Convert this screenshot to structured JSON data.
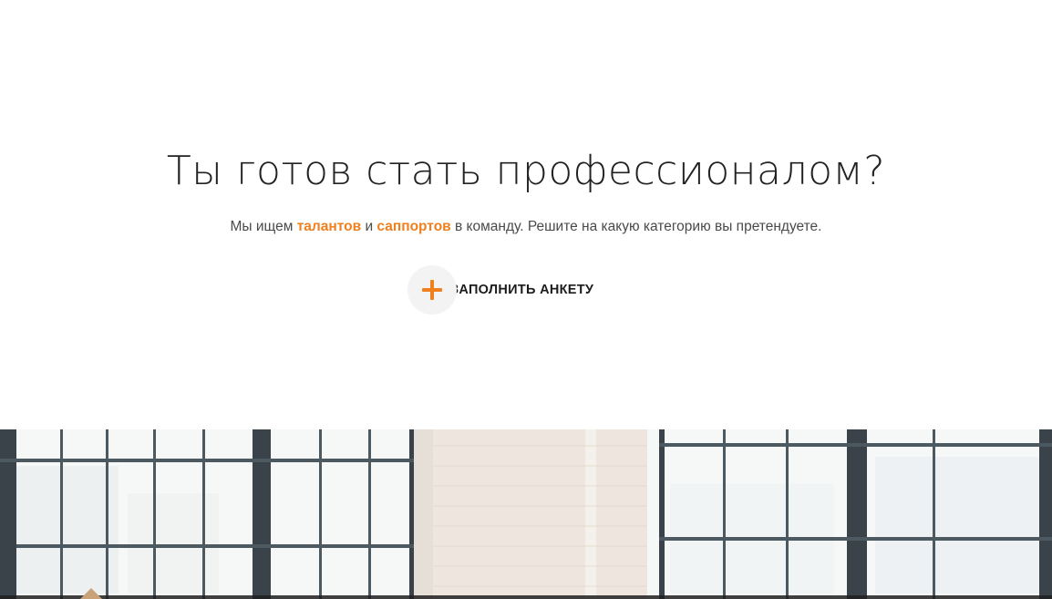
{
  "hero": {
    "title": "Ты готов стать профессионалом?",
    "subtitle": {
      "prefix": "Мы ищем ",
      "link1": "талантов",
      "middle": " и ",
      "link2": "саппортов",
      "suffix": " в команду. Решите на какую категорию вы претендуете."
    },
    "cta": {
      "label": "ЗАПОЛНИТЬ АНКЕТУ",
      "icon": "plus-icon"
    }
  },
  "colors": {
    "accent": "#f07f1d",
    "text": "#222222",
    "muted": "#4a4a4a",
    "background": "#ffffff"
  },
  "photo": {
    "subject": "office-windows-photo"
  }
}
